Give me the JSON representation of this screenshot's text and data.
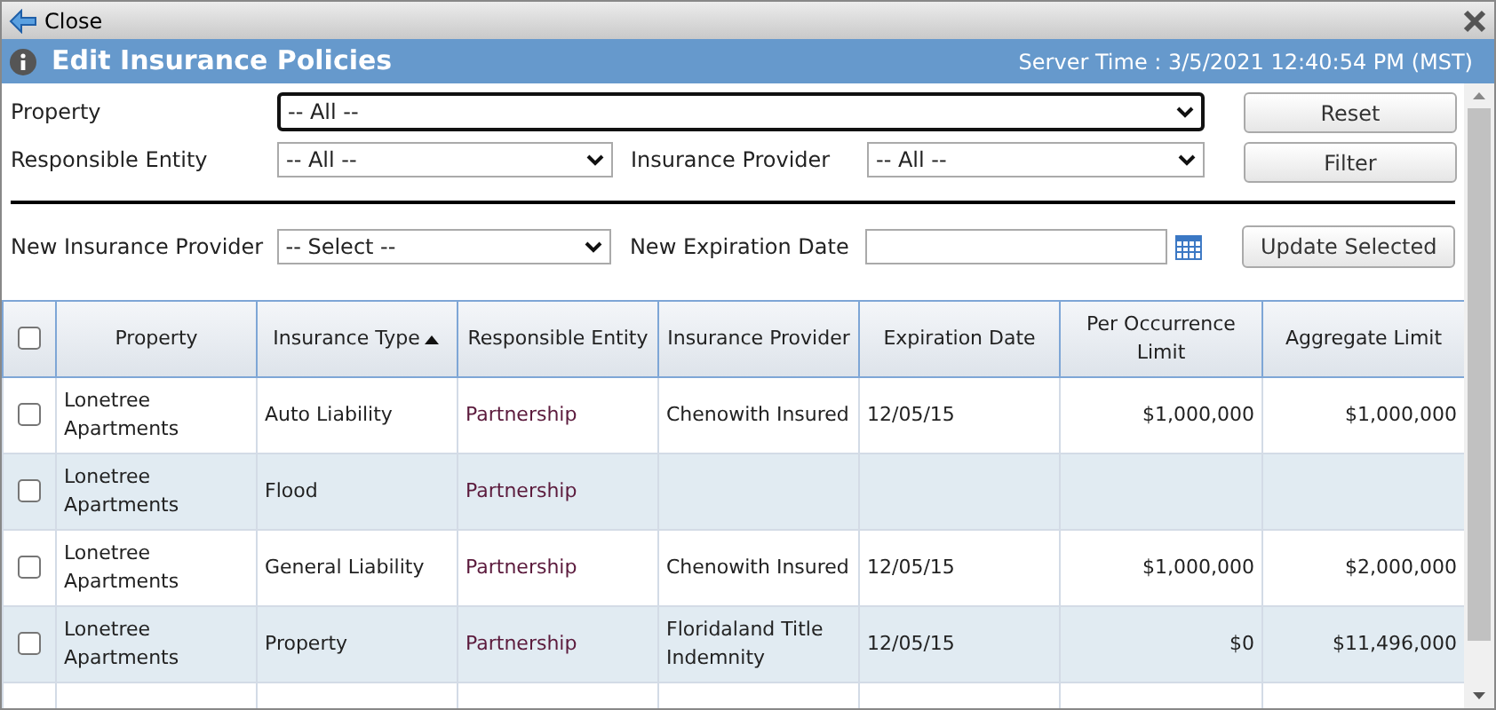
{
  "top_bar": {
    "close_label": "Close"
  },
  "header": {
    "title": "Edit Insurance Policies",
    "server_time": "Server Time : 3/5/2021 12:40:54 PM (MST)"
  },
  "filters": {
    "property": {
      "label": "Property",
      "value": "-- All --",
      "focused": true
    },
    "responsible_entity": {
      "label": "Responsible Entity",
      "value": "-- All --"
    },
    "insurance_provider": {
      "label": "Insurance Provider",
      "value": "-- All --"
    },
    "reset_button": "Reset",
    "filter_button": "Filter"
  },
  "update": {
    "provider": {
      "label": "New Insurance Provider",
      "value": "-- Select --"
    },
    "expiration": {
      "label": "New Expiration Date"
    },
    "update_button": "Update Selected"
  },
  "table": {
    "select_all_checked": false,
    "columns": [
      {
        "label": "Property",
        "sorted": false
      },
      {
        "label": "Insurance Type",
        "sorted": true
      },
      {
        "label": "Responsible Entity",
        "sorted": false
      },
      {
        "label": "Insurance Provider",
        "sorted": false
      },
      {
        "label": "Expiration Date",
        "sorted": false
      },
      {
        "label": "Per Occurrence Limit",
        "sorted": false
      },
      {
        "label": "Aggregate Limit",
        "sorted": false
      }
    ],
    "rows": [
      {
        "checked": false,
        "cells": [
          "Lonetree Apartments",
          "Auto Liability",
          "Partnership",
          "Chenowith Insured",
          "12/05/15",
          "$1,000,000",
          "$1,000,000"
        ]
      },
      {
        "checked": false,
        "cells": [
          "Lonetree Apartments",
          "Flood",
          "Partnership",
          "",
          "",
          "",
          ""
        ]
      },
      {
        "checked": false,
        "cells": [
          "Lonetree Apartments",
          "General Liability",
          "Partnership",
          "Chenowith Insured",
          "12/05/15",
          "$1,000,000",
          "$2,000,000"
        ]
      },
      {
        "checked": false,
        "cells": [
          "Lonetree Apartments",
          "Property",
          "Partnership",
          "Floridaland Title Indemnity",
          "12/05/15",
          "$0",
          "$11,496,000"
        ]
      }
    ]
  }
}
